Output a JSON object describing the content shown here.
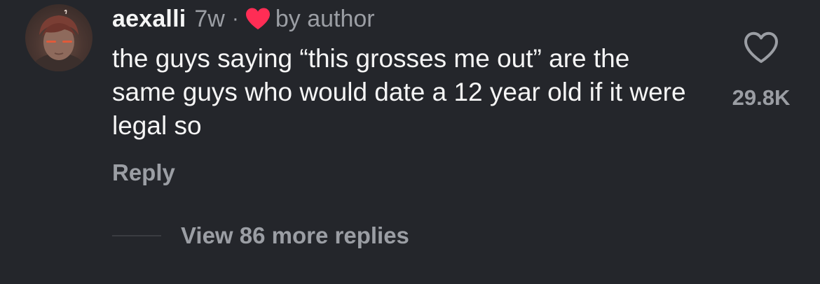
{
  "comment": {
    "username": "aexalli",
    "time_ago": "7w",
    "separator": "·",
    "author_badge_label": "by author",
    "author_badge_icon": "red-heart-icon",
    "author_badge_color": "#ff2d55",
    "body": "the guys saying “this grosses me out” are the same guys who would date a 12 year old if it were legal so",
    "reply_label": "Reply",
    "like_icon": "heart-outline-icon",
    "like_count": "29.8K",
    "view_replies_label": "View 86 more replies"
  },
  "colors": {
    "background": "#24262b",
    "primary_text": "#f5f5f5",
    "secondary_text": "#9b9ea4"
  }
}
